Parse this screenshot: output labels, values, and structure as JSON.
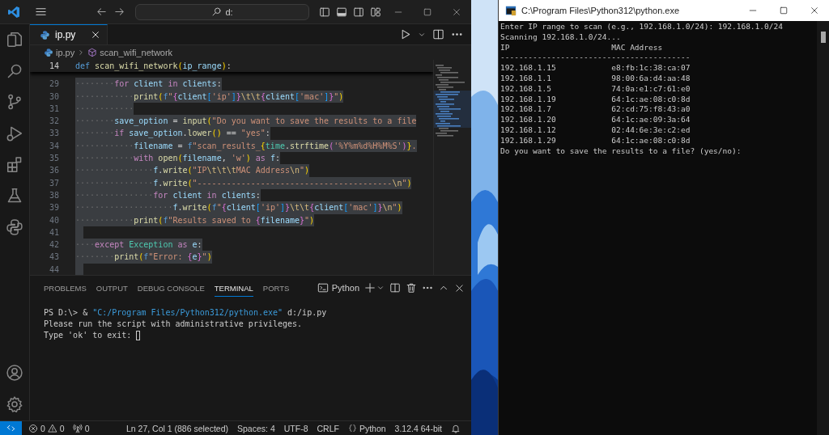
{
  "vscode": {
    "search": {
      "value": "d:"
    },
    "editor": {
      "tabs": [
        {
          "label": "ip.py",
          "selected": true
        }
      ],
      "breadcrumb": {
        "file": "ip.py",
        "symbol": "scan_wifi_network"
      },
      "sticky_line": {
        "number": "14",
        "tokens": [
          {
            "text": "def ",
            "kind": "def"
          },
          {
            "text": "scan_wifi_network",
            "kind": "fn"
          },
          {
            "text": "(",
            "kind": "b1"
          },
          {
            "text": "ip_range",
            "kind": "var"
          },
          {
            "text": ")",
            "kind": "b1"
          },
          {
            "text": ":",
            "kind": "op"
          }
        ]
      },
      "lines": [
        {
          "number": "29",
          "selected": true,
          "tokens": [
            {
              "text": "········",
              "kind": "dots"
            },
            {
              "text": "for ",
              "kind": "kw"
            },
            {
              "text": "client ",
              "kind": "var"
            },
            {
              "text": "in ",
              "kind": "kw"
            },
            {
              "text": "clients",
              "kind": "var"
            },
            {
              "text": ":",
              "kind": "op"
            }
          ]
        },
        {
          "number": "30",
          "selected": true,
          "tokens": [
            {
              "text": "············",
              "kind": "dots"
            },
            {
              "text": "print",
              "kind": "fn"
            },
            {
              "text": "(",
              "kind": "b1"
            },
            {
              "text": "f",
              "kind": "def"
            },
            {
              "text": "\"",
              "kind": "str"
            },
            {
              "text": "{",
              "kind": "b2"
            },
            {
              "text": "client",
              "kind": "var"
            },
            {
              "text": "[",
              "kind": "b3"
            },
            {
              "text": "'ip'",
              "kind": "str"
            },
            {
              "text": "]",
              "kind": "b3"
            },
            {
              "text": "}",
              "kind": "b2"
            },
            {
              "text": "\\t\\t",
              "kind": "esc"
            },
            {
              "text": "{",
              "kind": "b2"
            },
            {
              "text": "client",
              "kind": "var"
            },
            {
              "text": "[",
              "kind": "b3"
            },
            {
              "text": "'mac'",
              "kind": "str"
            },
            {
              "text": "]",
              "kind": "b3"
            },
            {
              "text": "}",
              "kind": "b2"
            },
            {
              "text": "\"",
              "kind": "str"
            },
            {
              "text": ")",
              "kind": "b1"
            }
          ]
        },
        {
          "number": "31",
          "selected": true,
          "tokens": [
            {
              "text": "············",
              "kind": "dots"
            }
          ]
        },
        {
          "number": "32",
          "selected": true,
          "tokens": [
            {
              "text": "········",
              "kind": "dots"
            },
            {
              "text": "save_option ",
              "kind": "var"
            },
            {
              "text": "= ",
              "kind": "op"
            },
            {
              "text": "input",
              "kind": "fn"
            },
            {
              "text": "(",
              "kind": "b1"
            },
            {
              "text": "\"Do you want to save the results to a file",
              "kind": "str"
            }
          ]
        },
        {
          "number": "33",
          "selected": true,
          "tokens": [
            {
              "text": "········",
              "kind": "dots"
            },
            {
              "text": "if ",
              "kind": "kw"
            },
            {
              "text": "save_option",
              "kind": "var"
            },
            {
              "text": ".",
              "kind": "op"
            },
            {
              "text": "lower",
              "kind": "fn"
            },
            {
              "text": "()",
              "kind": "b1"
            },
            {
              "text": " == ",
              "kind": "op"
            },
            {
              "text": "\"yes\"",
              "kind": "str"
            },
            {
              "text": ":",
              "kind": "op"
            }
          ]
        },
        {
          "number": "34",
          "selected": true,
          "tokens": [
            {
              "text": "············",
              "kind": "dots"
            },
            {
              "text": "filename ",
              "kind": "var"
            },
            {
              "text": "= ",
              "kind": "op"
            },
            {
              "text": "f",
              "kind": "def"
            },
            {
              "text": "\"scan_results_",
              "kind": "str"
            },
            {
              "text": "{",
              "kind": "b1"
            },
            {
              "text": "time",
              "kind": "cls"
            },
            {
              "text": ".",
              "kind": "op"
            },
            {
              "text": "strftime",
              "kind": "fn"
            },
            {
              "text": "(",
              "kind": "b2"
            },
            {
              "text": "'%Y%m%d%H%M%S'",
              "kind": "str"
            },
            {
              "text": ")",
              "kind": "b2"
            },
            {
              "text": "}",
              "kind": "b1"
            },
            {
              "text": ".",
              "kind": "str"
            }
          ]
        },
        {
          "number": "35",
          "selected": true,
          "tokens": [
            {
              "text": "············",
              "kind": "dots"
            },
            {
              "text": "with ",
              "kind": "kw"
            },
            {
              "text": "open",
              "kind": "fn"
            },
            {
              "text": "(",
              "kind": "b1"
            },
            {
              "text": "filename",
              "kind": "var"
            },
            {
              "text": ", ",
              "kind": "op"
            },
            {
              "text": "'w'",
              "kind": "str"
            },
            {
              "text": ")",
              "kind": "b1"
            },
            {
              "text": " as ",
              "kind": "kw"
            },
            {
              "text": "f",
              "kind": "var"
            },
            {
              "text": ":",
              "kind": "op"
            }
          ]
        },
        {
          "number": "36",
          "selected": true,
          "tokens": [
            {
              "text": "················",
              "kind": "dots"
            },
            {
              "text": "f",
              "kind": "var"
            },
            {
              "text": ".",
              "kind": "op"
            },
            {
              "text": "write",
              "kind": "fn"
            },
            {
              "text": "(",
              "kind": "b1"
            },
            {
              "text": "\"IP",
              "kind": "str"
            },
            {
              "text": "\\t\\t\\t",
              "kind": "esc"
            },
            {
              "text": "MAC Address",
              "kind": "str"
            },
            {
              "text": "\\n",
              "kind": "esc"
            },
            {
              "text": "\"",
              "kind": "str"
            },
            {
              "text": ")",
              "kind": "b1"
            }
          ]
        },
        {
          "number": "37",
          "selected": true,
          "tokens": [
            {
              "text": "················",
              "kind": "dots"
            },
            {
              "text": "f",
              "kind": "var"
            },
            {
              "text": ".",
              "kind": "op"
            },
            {
              "text": "write",
              "kind": "fn"
            },
            {
              "text": "(",
              "kind": "b1"
            },
            {
              "text": "\"----------------------------------------",
              "kind": "str"
            },
            {
              "text": "\\n",
              "kind": "esc"
            },
            {
              "text": "\"",
              "kind": "str"
            },
            {
              "text": ")",
              "kind": "b1"
            }
          ]
        },
        {
          "number": "38",
          "selected": true,
          "tokens": [
            {
              "text": "················",
              "kind": "dots"
            },
            {
              "text": "for ",
              "kind": "kw"
            },
            {
              "text": "client ",
              "kind": "var"
            },
            {
              "text": "in ",
              "kind": "kw"
            },
            {
              "text": "clients",
              "kind": "var"
            },
            {
              "text": ":",
              "kind": "op"
            }
          ]
        },
        {
          "number": "39",
          "selected": true,
          "tokens": [
            {
              "text": "····················",
              "kind": "dots"
            },
            {
              "text": "f",
              "kind": "var"
            },
            {
              "text": ".",
              "kind": "op"
            },
            {
              "text": "write",
              "kind": "fn"
            },
            {
              "text": "(",
              "kind": "b1"
            },
            {
              "text": "f",
              "kind": "def"
            },
            {
              "text": "\"",
              "kind": "str"
            },
            {
              "text": "{",
              "kind": "b2"
            },
            {
              "text": "client",
              "kind": "var"
            },
            {
              "text": "[",
              "kind": "b3"
            },
            {
              "text": "'ip'",
              "kind": "str"
            },
            {
              "text": "]",
              "kind": "b3"
            },
            {
              "text": "}",
              "kind": "b2"
            },
            {
              "text": "\\t\\t",
              "kind": "esc"
            },
            {
              "text": "{",
              "kind": "b2"
            },
            {
              "text": "client",
              "kind": "var"
            },
            {
              "text": "[",
              "kind": "b3"
            },
            {
              "text": "'mac'",
              "kind": "str"
            },
            {
              "text": "]",
              "kind": "b3"
            },
            {
              "text": "}",
              "kind": "b2"
            },
            {
              "text": "\\n",
              "kind": "esc"
            },
            {
              "text": "\"",
              "kind": "str"
            },
            {
              "text": ")",
              "kind": "b1"
            }
          ]
        },
        {
          "number": "40",
          "selected": true,
          "tokens": [
            {
              "text": "············",
              "kind": "dots"
            },
            {
              "text": "print",
              "kind": "fn"
            },
            {
              "text": "(",
              "kind": "b1"
            },
            {
              "text": "f",
              "kind": "def"
            },
            {
              "text": "\"Results saved to ",
              "kind": "str"
            },
            {
              "text": "{",
              "kind": "b2"
            },
            {
              "text": "filename",
              "kind": "var"
            },
            {
              "text": "}",
              "kind": "b2"
            },
            {
              "text": "\"",
              "kind": "str"
            },
            {
              "text": ")",
              "kind": "b1"
            }
          ]
        },
        {
          "number": "41",
          "selected": true
        },
        {
          "number": "42",
          "selected": true,
          "tokens": [
            {
              "text": "····",
              "kind": "dots"
            },
            {
              "text": "except ",
              "kind": "kw"
            },
            {
              "text": "Exception",
              "kind": "cls"
            },
            {
              "text": " as ",
              "kind": "kw"
            },
            {
              "text": "e",
              "kind": "var"
            },
            {
              "text": ":",
              "kind": "op"
            }
          ]
        },
        {
          "number": "43",
          "selected": true,
          "tokens": [
            {
              "text": "········",
              "kind": "dots"
            },
            {
              "text": "print",
              "kind": "fn"
            },
            {
              "text": "(",
              "kind": "b1"
            },
            {
              "text": "f",
              "kind": "def"
            },
            {
              "text": "\"Error: ",
              "kind": "str"
            },
            {
              "text": "{",
              "kind": "b2"
            },
            {
              "text": "e",
              "kind": "var"
            },
            {
              "text": "}",
              "kind": "b2"
            },
            {
              "text": "\"",
              "kind": "str"
            },
            {
              "text": ")",
              "kind": "b1"
            }
          ]
        },
        {
          "number": "44",
          "selected": true
        }
      ]
    },
    "panel": {
      "tabs": [
        {
          "label": "PROBLEMS",
          "selected": false
        },
        {
          "label": "OUTPUT",
          "selected": false
        },
        {
          "label": "DEBUG CONSOLE",
          "selected": false
        },
        {
          "label": "TERMINAL",
          "selected": true
        },
        {
          "label": "PORTS",
          "selected": false
        }
      ],
      "terminal_profile": "Python",
      "terminal_lines": [
        {
          "segments": [
            {
              "text": "PS D:\\> & ",
              "kind": "plain"
            },
            {
              "text": "\"C:/Program Files/Python312/python.exe\"",
              "kind": "string"
            },
            {
              "text": " d:/ip.py",
              "kind": "plain"
            }
          ],
          "cursor": false
        },
        {
          "segments": [
            {
              "text": "Please run the script with administrative privileges.",
              "kind": "plain"
            }
          ],
          "cursor": false
        },
        {
          "segments": [
            {
              "text": "Type 'ok' to exit: ",
              "kind": "plain"
            }
          ],
          "cursor": true
        }
      ]
    },
    "status_bar": {
      "errors": "0",
      "warnings": "0",
      "ports": "0",
      "cursor": "Ln 27, Col 1 (886 selected)",
      "indentation": "Spaces: 4",
      "encoding": "UTF-8",
      "line_ending": "CRLF",
      "language": "Python",
      "interpreter": "3.12.4 64-bit"
    }
  },
  "console": {
    "title": "C:\\Program Files\\Python312\\python.exe",
    "lines": [
      {
        "kind": "text",
        "text": "Enter IP range to scan (e.g., 192.168.1.0/24): 192.168.1.0/24"
      },
      {
        "kind": "text",
        "text": "Scanning 192.168.1.0/24..."
      },
      {
        "kind": "row",
        "cells": [
          "IP",
          "MAC Address"
        ]
      },
      {
        "kind": "text",
        "text": "-----------------------------------------"
      },
      {
        "kind": "row",
        "cells": [
          "192.168.1.15",
          "e8:fb:1c:38:ca:07"
        ]
      },
      {
        "kind": "row",
        "cells": [
          "192.168.1.1",
          "98:00:6a:d4:aa:48"
        ]
      },
      {
        "kind": "row",
        "cells": [
          "192.168.1.5",
          "74:0a:e1:c7:61:e0"
        ]
      },
      {
        "kind": "row",
        "cells": [
          "192.168.1.19",
          "64:1c:ae:08:c0:8d"
        ]
      },
      {
        "kind": "row",
        "cells": [
          "192.168.1.7",
          "62:cd:75:f8:43:a0"
        ]
      },
      {
        "kind": "row",
        "cells": [
          "192.168.1.20",
          "64:1c:ae:09:3a:64"
        ]
      },
      {
        "kind": "row",
        "cells": [
          "192.168.1.12",
          "02:44:6e:3e:c2:ed"
        ]
      },
      {
        "kind": "row",
        "cells": [
          "192.168.1.29",
          "64:1c:ae:08:c0:8d"
        ]
      },
      {
        "kind": "text",
        "text": "Do you want to save the results to a file? (yes/no):"
      }
    ]
  }
}
